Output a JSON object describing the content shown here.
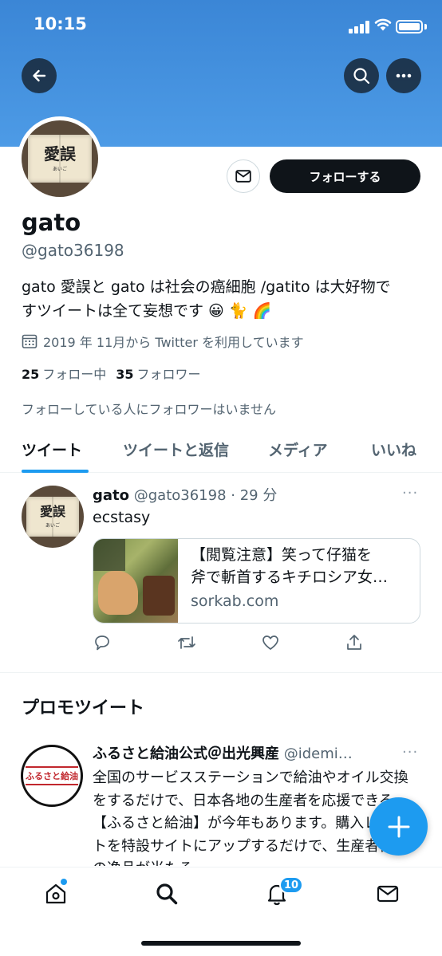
{
  "status_bar": {
    "time": "10:15"
  },
  "profile": {
    "avatar_title": "愛誤",
    "avatar_subtitle": "あいご",
    "follow_label": "フォローする",
    "display_name": "gato",
    "handle": "@gato36198",
    "bio_line1": "gato 愛誤と gato は社会の癌細胞 /gatito は大好物で",
    "bio_line2": "すツイートは全て妄想です 😀 🐈 🌈",
    "joined": "2019 年 11月から Twitter を利用しています",
    "following_count": "25",
    "following_label": "フォロー中",
    "followers_count": "35",
    "followers_label": "フォロワー",
    "no_mutual_followers": "フォローしている人にフォロワーはいません"
  },
  "tabs": [
    {
      "label": "ツイート",
      "active": true
    },
    {
      "label": "ツイートと返信"
    },
    {
      "label": "メディア"
    },
    {
      "label": "いいね"
    }
  ],
  "tweet": {
    "name": "gato",
    "handle_time": "@gato36198 · 29 分",
    "text": "ecstasy",
    "more": "···",
    "link_title_line1": "【閲覧注意】笑って仔猫を",
    "link_title_line2": "斧で斬首するキチロシア女…",
    "link_domain": "sorkab.com"
  },
  "promoted": {
    "section_title": "プロモツイート",
    "logo_text": "ふるさと給油",
    "name": "ふるさと給油公式＠出光興産",
    "handle": "@idemi…",
    "more": "···",
    "body": "全国のサービスステーションで給油やオイル交換をするだけで、日本各地の生産者を応援できる【ふるさと給油】が今年もあります。購入レシートを特設サイトにアップするだけで、生産者自慢の逸品が当たる"
  },
  "bottom_nav": {
    "notification_count": "10"
  },
  "colors": {
    "accent": "#1d9bf0",
    "banner": "#4a95e0",
    "text": "#0f1419",
    "muted": "#536471"
  }
}
